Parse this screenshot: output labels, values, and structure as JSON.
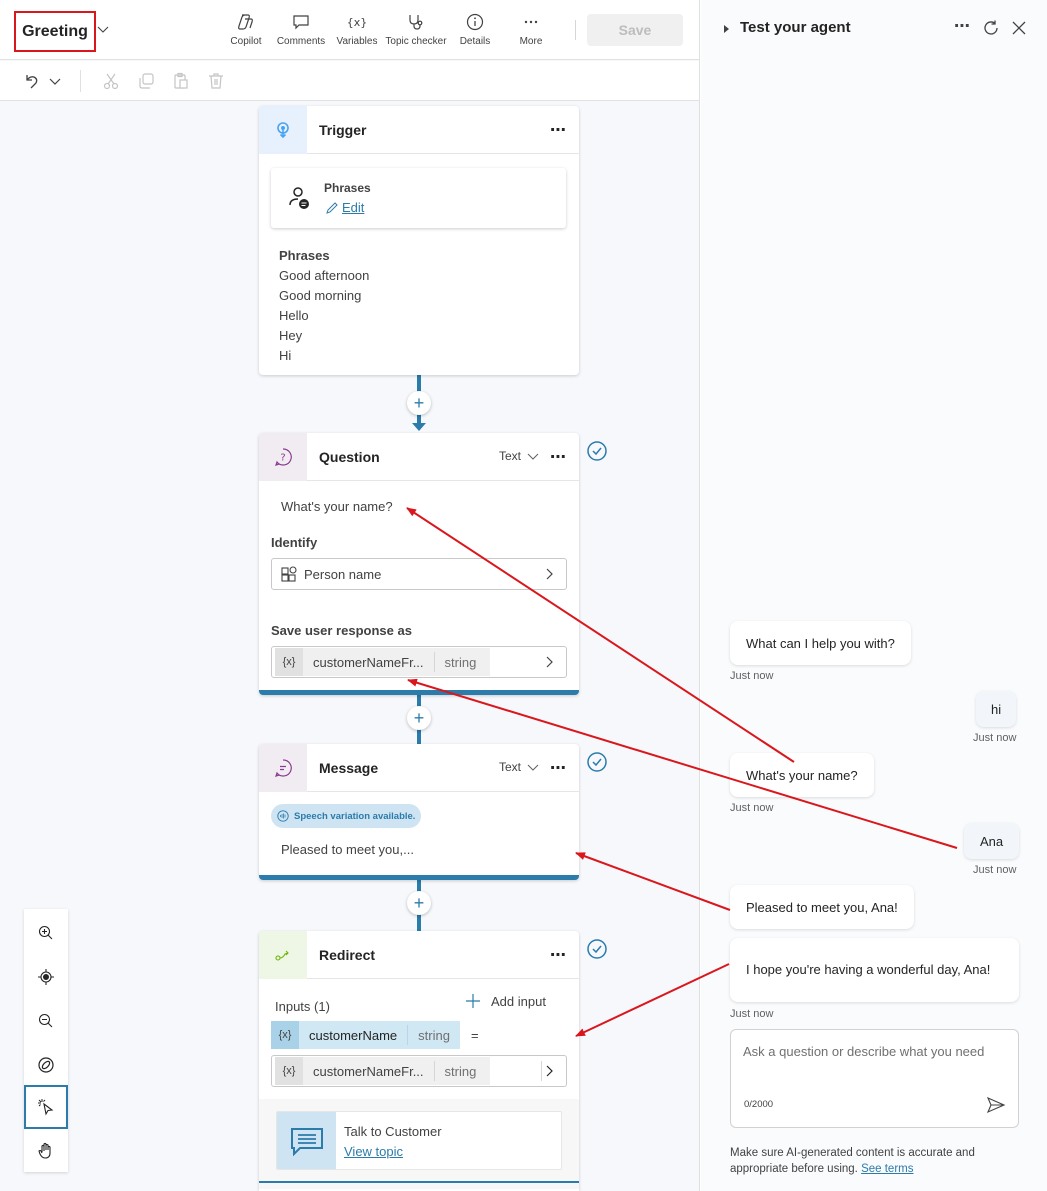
{
  "header": {
    "topic_title": "Greeting",
    "tools": [
      {
        "label": "Copilot",
        "icon": "copilot-icon"
      },
      {
        "label": "Comments",
        "icon": "comment-icon"
      },
      {
        "label": "Variables",
        "icon": "variables-icon"
      },
      {
        "label": "Topic checker",
        "icon": "stethoscope-icon"
      },
      {
        "label": "Details",
        "icon": "info-icon"
      },
      {
        "label": "More",
        "icon": "more-icon"
      }
    ],
    "save_label": "Save"
  },
  "edit_toolbar": {
    "icons": [
      "undo-icon",
      "chevron-down-icon",
      "cut-icon",
      "copy-icon",
      "paste-icon",
      "delete-icon"
    ]
  },
  "canvas": {
    "trigger": {
      "title": "Trigger",
      "card_title": "Phrases",
      "edit_label": "Edit",
      "phrases_heading": "Phrases",
      "phrases": [
        "Good afternoon",
        "Good morning",
        "Hello",
        "Hey",
        "Hi"
      ]
    },
    "question": {
      "title": "Question",
      "type": "Text",
      "prompt": "What's your name?",
      "identify_label": "Identify",
      "identify_value": "Person name",
      "save_label": "Save user response as",
      "variable_name": "customerNameFr...",
      "variable_type": "string"
    },
    "message": {
      "title": "Message",
      "type": "Text",
      "badge": "Speech variation available.",
      "text": "Pleased to meet you,..."
    },
    "redirect": {
      "title": "Redirect",
      "inputs_label": "Inputs (1)",
      "add_input_label": "Add input",
      "input_name": "customerName",
      "input_type": "string",
      "equals": "=",
      "value_name": "customerNameFr...",
      "value_type": "string",
      "topic_name": "Talk to Customer",
      "view_topic_label": "View topic"
    },
    "variable_glyph": "{x}",
    "more_glyph": "⋯",
    "plus_glyph": "+"
  },
  "zoom_toolbar": {
    "items": [
      "zoom-in-icon",
      "recenter-icon",
      "zoom-out-icon",
      "minimap-icon",
      "select-icon",
      "pan-hand-icon"
    ],
    "active": "select-icon"
  },
  "test_panel": {
    "title": "Test your agent",
    "messages": [
      {
        "from": "agent",
        "text": "What can I help you with?",
        "time": "Just now"
      },
      {
        "from": "user",
        "text": "hi",
        "time": "Just now"
      },
      {
        "from": "agent",
        "text": "What's your name?",
        "time": "Just now"
      },
      {
        "from": "user",
        "text": "Ana",
        "time": "Just now"
      },
      {
        "from": "agent",
        "text": "Pleased to meet you, Ana!",
        "time": ""
      },
      {
        "from": "agent",
        "text": "I hope you're having a wonderful day, Ana!",
        "time": "Just now"
      }
    ],
    "input_placeholder": "Ask a question or describe what you need",
    "char_count": "0/2000",
    "disclaimer": "Make sure AI-generated content is accurate and appropriate before using.",
    "terms_link": "See terms"
  },
  "colors": {
    "accent": "#2b7bab",
    "annotation_red": "#d9171c",
    "speech_badge_bg": "#cfe4f2"
  }
}
